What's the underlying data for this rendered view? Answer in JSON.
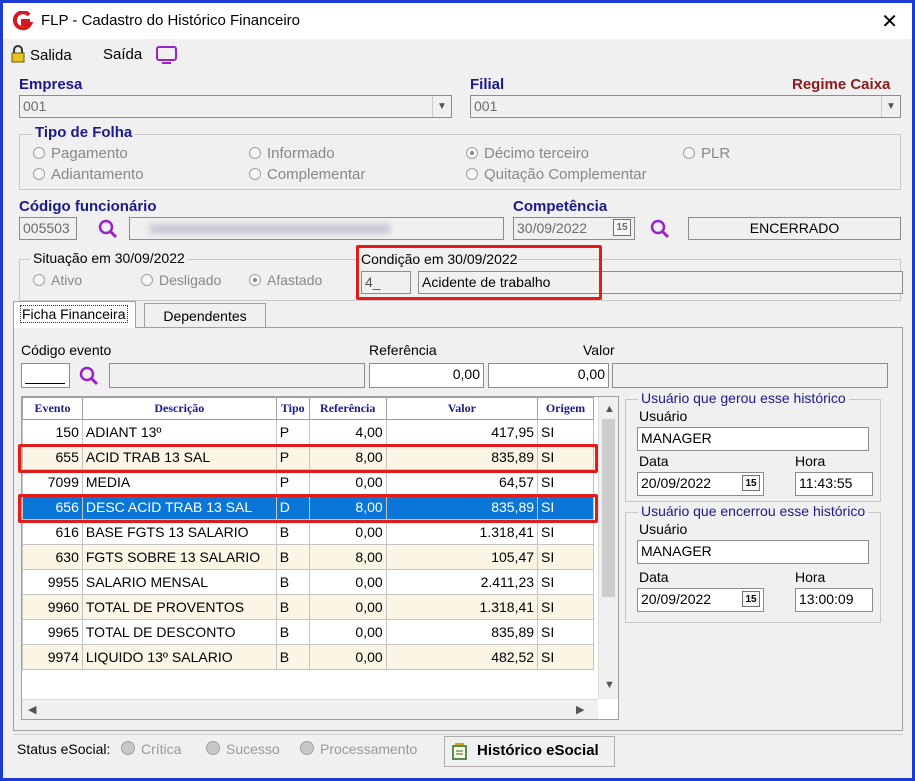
{
  "window": {
    "title": "FLP - Cadastro do Histórico Financeiro",
    "close_glyph": "✕"
  },
  "toolbar": {
    "exit_label": "Salida",
    "exit2_label": "Saída"
  },
  "empresa": {
    "label": "Empresa",
    "value": "001"
  },
  "filial": {
    "label": "Filial",
    "value": "001",
    "regime": "Regime Caixa"
  },
  "tipo_folha": {
    "title": "Tipo de Folha",
    "options": [
      "Pagamento",
      "Informado",
      "Décimo terceiro",
      "PLR",
      "Adiantamento",
      "Complementar",
      "Quitação Complementar"
    ],
    "selected": "Décimo terceiro"
  },
  "funcionario": {
    "label": "Código funcionário",
    "code": "005503"
  },
  "competencia": {
    "label": "Competência",
    "value": "30/09/2022",
    "status": "ENCERRADO",
    "cal_glyph": "15"
  },
  "situacao": {
    "title": "Situação em 30/09/2022",
    "options": [
      "Ativo",
      "Desligado",
      "Afastado"
    ],
    "selected": "Afastado"
  },
  "condicao": {
    "title": "Condição em 30/09/2022",
    "code": "4_",
    "desc": "Acidente de trabalho"
  },
  "tabs": [
    "Ficha Financeira",
    "Dependentes"
  ],
  "filter": {
    "evento_label": "Código evento",
    "ref_label": "Referência",
    "valor_label": "Valor",
    "ref_value": "0,00",
    "valor_value": "0,00"
  },
  "grid": {
    "headers": [
      "Evento",
      "Descrição",
      "Tipo",
      "Referência",
      "Valor",
      "Origem"
    ],
    "rows": [
      [
        "150",
        "ADIANT 13º",
        "P",
        "4,00",
        "417,95",
        "SI"
      ],
      [
        "655",
        "ACID TRAB 13 SAL",
        "P",
        "8,00",
        "835,89",
        "SI"
      ],
      [
        "7099",
        "MEDIA",
        "P",
        "0,00",
        "64,57",
        "SI"
      ],
      [
        "656",
        "DESC ACID TRAB 13 SAL",
        "D",
        "8,00",
        "835,89",
        "SI"
      ],
      [
        "616",
        "BASE FGTS 13 SALARIO",
        "B",
        "0,00",
        "1.318,41",
        "SI"
      ],
      [
        "630",
        "FGTS SOBRE 13 SALARIO",
        "B",
        "8,00",
        "105,47",
        "SI"
      ],
      [
        "9955",
        "SALARIO MENSAL",
        "B",
        "0,00",
        "2.411,23",
        "SI"
      ],
      [
        "9960",
        "TOTAL DE PROVENTOS",
        "B",
        "0,00",
        "1.318,41",
        "SI"
      ],
      [
        "9965",
        "TOTAL DE DESCONTO",
        "B",
        "0,00",
        "835,89",
        "SI"
      ],
      [
        "9974",
        "LIQUIDO 13º SALARIO",
        "B",
        "0,00",
        "482,52",
        "SI"
      ]
    ]
  },
  "gerou": {
    "title": "Usuário que gerou esse histórico",
    "user_label": "Usuário",
    "user": "MANAGER",
    "data_label": "Data",
    "data": "20/09/2022",
    "hora_label": "Hora",
    "hora": "11:43:55"
  },
  "encerrou": {
    "title": "Usuário que encerrou esse histórico",
    "user_label": "Usuário",
    "user": "MANAGER",
    "data_label": "Data",
    "data": "20/09/2022",
    "hora_label": "Hora",
    "hora": "13:00:09"
  },
  "footer": {
    "status_label": "Status eSocial:",
    "options": [
      "Crítica",
      "Sucesso",
      "Processamento"
    ],
    "button": "Histórico eSocial"
  },
  "colors": {
    "accent": "#1a1a8c",
    "border": "#1c3bd3",
    "highlight": "#e21b1b",
    "selection": "#0a77d8",
    "regime": "#8b1a1a"
  }
}
